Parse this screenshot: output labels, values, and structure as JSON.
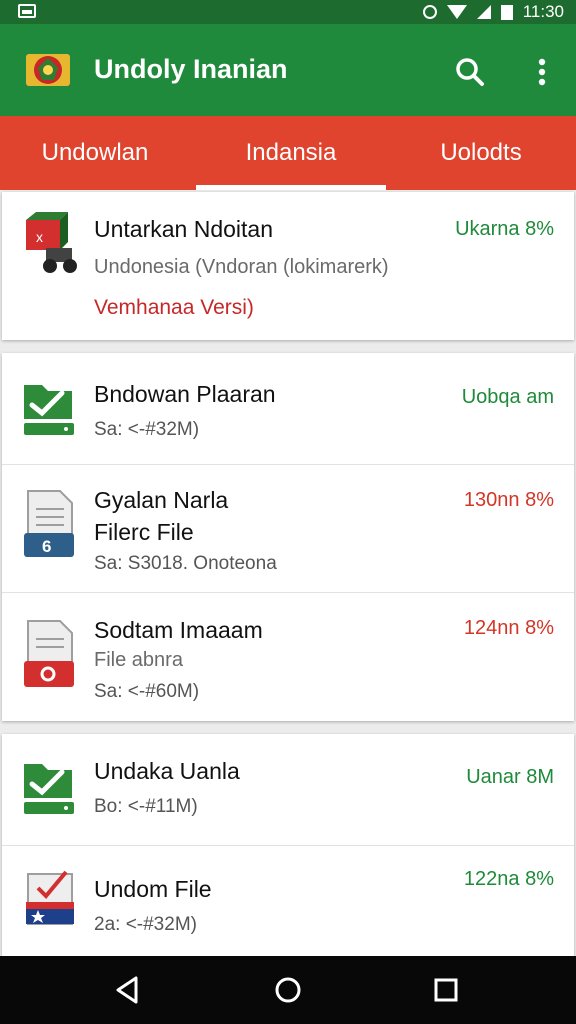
{
  "status_bar": {
    "time": "11:30"
  },
  "app_bar": {
    "title": "Undoly Inanian",
    "icons": {
      "logo": "emblem-logo",
      "search": "search-icon",
      "menu": "more-vert-icon"
    }
  },
  "tabs": [
    {
      "label": "Undowlan",
      "selected": false
    },
    {
      "label": "Indansia",
      "selected": true
    },
    {
      "label": "Uolodts",
      "selected": false
    }
  ],
  "featured": {
    "title": "Untarkan Ndoitan",
    "subtitle": "Undonesia (Vndoran (lokimarerk)",
    "link": "Vemhanaa Versi)",
    "right": "Ukarna 8%"
  },
  "group1": [
    {
      "title": "Bndowan Plaaran",
      "meta": "Sa: <-#32M)",
      "right": "Uobqa am",
      "right_color": "green",
      "icon": "folder-check-icon"
    },
    {
      "title": "Gyalan Narla",
      "title2": "Filerc File",
      "meta": "Sa: S3018. Onoteona",
      "right": "130nn 8%",
      "right_color": "red",
      "icon": "document-icon"
    },
    {
      "title": "Sodtam Imaaam",
      "sub": "File abnra",
      "meta": "Sa: <-#60M)",
      "right": "124nn 8%",
      "right_color": "red",
      "icon": "pdf-file-icon"
    }
  ],
  "group2": [
    {
      "title": "Undaka Uanla",
      "meta": "Bo: <-#11M)",
      "right": "Uanar 8M",
      "right_color": "green",
      "icon": "folder-check-icon"
    },
    {
      "title": "Undom File",
      "meta": "2a: <-#32M)",
      "right": "122na 8%",
      "right_color": "green",
      "icon": "flag-document-icon"
    }
  ],
  "nav_icons": [
    "back-icon",
    "home-icon",
    "recents-icon"
  ],
  "colors": {
    "app_bar": "#1f8a3c",
    "tabs": "#e0432e",
    "accent_green": "#1e8a3a",
    "accent_red": "#d33626"
  }
}
